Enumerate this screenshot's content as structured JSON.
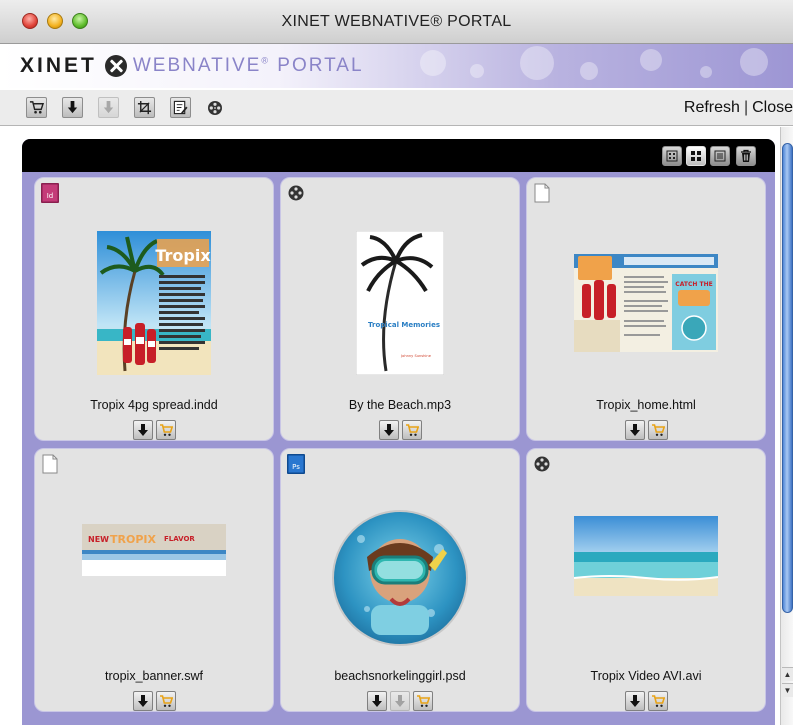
{
  "window": {
    "title": "XINET WEBNATIVE® PORTAL"
  },
  "banner": {
    "brand": "XINET",
    "product": "WEBNATIVE",
    "product_mark": "®",
    "product_suffix": "PORTAL"
  },
  "toolbar": {
    "icons": [
      "cart-icon",
      "download-icon",
      "download-disabled-icon",
      "crop-icon",
      "edit-icon",
      "reel-icon"
    ],
    "refresh_label": "Refresh",
    "separator": "|",
    "close_label": "Close"
  },
  "view_controls": [
    "view-small-icon",
    "view-grid-icon",
    "view-list-icon",
    "trash-icon"
  ],
  "tiles": [
    {
      "name": "Tropix 4pg spread.indd",
      "type_icon": "indesign-icon",
      "actions": [
        "download",
        "cart"
      ]
    },
    {
      "name": "By the Beach.mp3",
      "type_icon": "reel-icon",
      "actions": [
        "download",
        "cart"
      ],
      "thumb_title": "Tropical Memories",
      "thumb_author": "Johnny Sunshine"
    },
    {
      "name": "Tropix_home.html",
      "type_icon": "document-icon",
      "actions": [
        "download",
        "cart"
      ]
    },
    {
      "name": "tropix_banner.swf",
      "type_icon": "document-icon",
      "actions": [
        "download",
        "cart"
      ]
    },
    {
      "name": "beachsnorkelinggirl.psd",
      "type_icon": "photoshop-icon",
      "actions": [
        "download",
        "download-disabled",
        "cart"
      ]
    },
    {
      "name": "Tropix Video AVI.avi",
      "type_icon": "reel-icon",
      "actions": [
        "download",
        "cart"
      ]
    }
  ],
  "colors": {
    "panel_border": "#9b96d2",
    "tile_bg": "#e3e3e3",
    "cart_accent": "#e8a317",
    "scroll_thumb": "#4f86d6"
  }
}
